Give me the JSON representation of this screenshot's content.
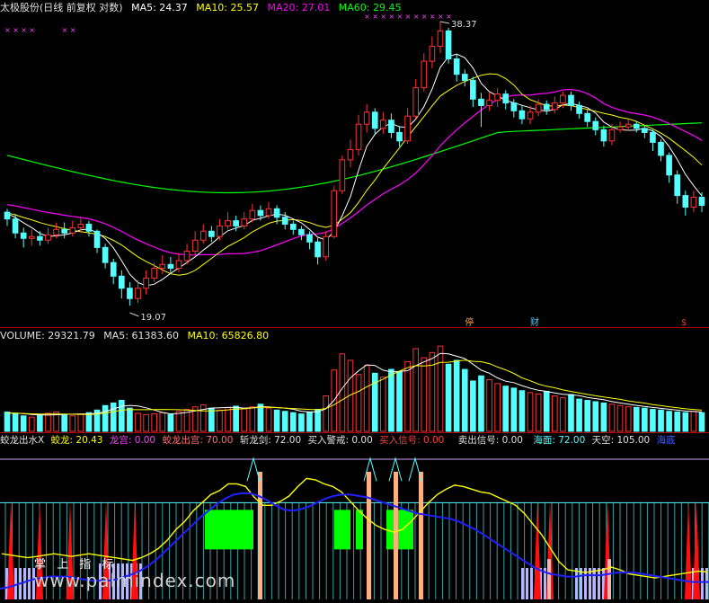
{
  "price_header": {
    "title": "太极股份(日线 前复权 对数)",
    "ma5": "MA5: 24.37",
    "ma10": "MA10: 25.57",
    "ma20": "MA20: 27.01",
    "ma60": "MA60: 29.45"
  },
  "price_annotations": {
    "high": "38.37",
    "low": "19.07",
    "marker1": "停",
    "marker2": "财",
    "marker3": "$"
  },
  "volume_header": {
    "volume": "VOLUME: 29321.79",
    "ma5": "MA5: 61383.60",
    "ma10": "MA10: 65826.80"
  },
  "indicator_header": {
    "name": "蛟龙出水X",
    "jiaolong": "蛟龙: 20.43",
    "longgong": "龙宫: 0.00",
    "chugong": "蛟龙出宫: 70.00",
    "zhanlongjian": "斩龙剑: 72.00",
    "maijing": "买入警戒: 0.00",
    "mairu": "买入信号: 0.00",
    "maichu": "卖出信号: 0.00",
    "haimian": "海面: 72.00",
    "tiankong": "天空: 105.00",
    "haidi": "海底"
  },
  "watermark": {
    "line1": "掌 上 指 标",
    "line2": "www.palmindex.com"
  },
  "colors": {
    "up": "#ff3232",
    "down": "#54ffff",
    "ma5": "#ffffff",
    "ma10": "#ffff00",
    "ma20": "#ff00ff",
    "ma60": "#00ff00",
    "separator": "#b00000"
  },
  "chart_data": {
    "type": "candlestick",
    "high_label": 38.37,
    "low_label": 19.07,
    "y_scale": "log",
    "candles": [
      [
        24,
        23.6,
        24.2,
        23.2
      ],
      [
        23.6,
        22.8,
        23.9,
        22.5
      ],
      [
        22.8,
        22.5,
        23.1,
        22.0
      ],
      [
        22.5,
        22.6,
        23.0,
        22.1
      ],
      [
        22.6,
        22.4,
        22.9,
        22.1
      ],
      [
        22.4,
        22.7,
        23.1,
        22.2
      ],
      [
        22.7,
        23.0,
        23.4,
        22.5
      ],
      [
        23.0,
        22.8,
        23.4,
        22.5
      ],
      [
        22.8,
        23.1,
        23.5,
        22.6
      ],
      [
        23.1,
        23.3,
        23.7,
        22.8
      ],
      [
        23.3,
        22.9,
        23.5,
        22.6
      ],
      [
        22.9,
        22.0,
        23.0,
        21.7
      ],
      [
        22.0,
        21.2,
        22.2,
        20.9
      ],
      [
        21.2,
        20.5,
        21.4,
        20.1
      ],
      [
        20.5,
        19.9,
        20.8,
        19.4
      ],
      [
        19.9,
        19.4,
        20.2,
        19.07
      ],
      [
        19.4,
        19.9,
        20.3,
        19.2
      ],
      [
        19.9,
        20.4,
        20.8,
        19.6
      ],
      [
        20.4,
        20.9,
        21.2,
        20.2
      ],
      [
        20.9,
        21.1,
        21.6,
        20.6
      ],
      [
        21.1,
        20.9,
        21.5,
        20.6
      ],
      [
        20.9,
        21.3,
        21.7,
        20.7
      ],
      [
        21.3,
        21.8,
        22.2,
        21.1
      ],
      [
        21.8,
        22.4,
        22.9,
        21.6
      ],
      [
        22.4,
        22.9,
        23.3,
        22.2
      ],
      [
        22.9,
        22.6,
        23.2,
        22.3
      ],
      [
        22.6,
        23.2,
        23.6,
        22.4
      ],
      [
        23.2,
        23.5,
        24.0,
        23.0
      ],
      [
        23.5,
        23.2,
        23.8,
        22.9
      ],
      [
        23.2,
        23.6,
        24.0,
        23.0
      ],
      [
        23.6,
        24.1,
        24.5,
        23.4
      ],
      [
        24.1,
        23.8,
        24.4,
        23.5
      ],
      [
        23.8,
        24.2,
        24.6,
        23.6
      ],
      [
        24.2,
        23.7,
        24.4,
        23.3
      ],
      [
        23.7,
        23.3,
        24.0,
        23.0
      ],
      [
        23.3,
        23.0,
        23.5,
        22.7
      ],
      [
        23.0,
        22.7,
        23.2,
        22.4
      ],
      [
        22.7,
        22.3,
        22.9,
        21.9
      ],
      [
        22.3,
        21.5,
        22.5,
        21.1
      ],
      [
        21.5,
        22.6,
        22.9,
        21.3
      ],
      [
        22.6,
        25.3,
        25.6,
        22.5
      ],
      [
        25.3,
        27.3,
        27.6,
        25.1
      ],
      [
        27.3,
        28.0,
        28.7,
        26.8
      ],
      [
        28.0,
        29.8,
        30.5,
        27.6
      ],
      [
        29.8,
        30.7,
        31.3,
        29.2
      ],
      [
        30.7,
        29.5,
        31.0,
        29.0
      ],
      [
        29.5,
        30.1,
        30.7,
        29.1
      ],
      [
        30.1,
        29.2,
        30.6,
        28.8
      ],
      [
        29.2,
        28.6,
        29.6,
        28.2
      ],
      [
        28.6,
        30.4,
        31.0,
        28.4
      ],
      [
        30.4,
        32.6,
        33.3,
        30.2
      ],
      [
        32.6,
        34.8,
        35.5,
        32.3
      ],
      [
        34.8,
        36.1,
        37.0,
        34.2
      ],
      [
        36.1,
        37.5,
        38.37,
        35.5
      ],
      [
        37.5,
        35.0,
        37.8,
        34.6
      ],
      [
        35.0,
        33.7,
        35.4,
        33.1
      ],
      [
        33.7,
        33.2,
        34.1,
        32.7
      ],
      [
        33.2,
        31.7,
        33.5,
        31.1
      ],
      [
        31.7,
        31.2,
        32.2,
        29.6
      ],
      [
        31.2,
        31.6,
        32.2,
        30.8
      ],
      [
        31.6,
        32.1,
        32.6,
        31.1
      ],
      [
        32.1,
        31.4,
        32.4,
        30.9
      ],
      [
        31.4,
        30.8,
        31.7,
        30.3
      ],
      [
        30.8,
        30.2,
        31.2,
        29.8
      ],
      [
        30.2,
        30.7,
        31.2,
        29.8
      ],
      [
        30.7,
        31.3,
        31.7,
        30.4
      ],
      [
        31.3,
        30.9,
        31.6,
        30.5
      ],
      [
        30.9,
        31.4,
        31.9,
        30.6
      ],
      [
        31.4,
        32.0,
        32.3,
        31.0
      ],
      [
        32.0,
        31.2,
        32.3,
        30.8
      ],
      [
        31.2,
        30.6,
        31.5,
        30.2
      ],
      [
        30.6,
        30.0,
        30.9,
        29.6
      ],
      [
        30.0,
        29.4,
        30.3,
        29.0
      ],
      [
        29.4,
        28.6,
        29.7,
        28.2
      ],
      [
        28.6,
        29.4,
        29.8,
        28.3
      ],
      [
        29.4,
        29.6,
        30.0,
        29.2
      ],
      [
        29.6,
        29.8,
        30.2,
        29.3
      ],
      [
        29.8,
        29.5,
        30.0,
        29.2
      ],
      [
        29.5,
        29.2,
        29.7,
        28.8
      ],
      [
        29.2,
        28.5,
        29.4,
        27.9
      ],
      [
        28.5,
        27.6,
        28.7,
        27.2
      ],
      [
        27.6,
        26.3,
        27.8,
        25.8
      ],
      [
        26.3,
        25.0,
        26.6,
        24.5
      ],
      [
        25.0,
        24.3,
        25.3,
        23.8
      ],
      [
        24.3,
        24.9,
        25.3,
        24.0
      ],
      [
        24.9,
        24.4,
        25.2,
        24.0
      ]
    ],
    "volumes": [
      30,
      27,
      24,
      22,
      25,
      28,
      30,
      26,
      24,
      27,
      29,
      33,
      40,
      44,
      48,
      36,
      28,
      26,
      27,
      29,
      26,
      31,
      34,
      38,
      41,
      36,
      33,
      37,
      39,
      35,
      38,
      42,
      36,
      33,
      31,
      29,
      27,
      30,
      34,
      55,
      95,
      120,
      110,
      88,
      102,
      90,
      84,
      96,
      92,
      108,
      128,
      114,
      122,
      132,
      104,
      110,
      96,
      78,
      86,
      80,
      74,
      70,
      67,
      63,
      60,
      58,
      62,
      55,
      52,
      57,
      50,
      48,
      46,
      44,
      42,
      40,
      38,
      37,
      36,
      34,
      33,
      31,
      30,
      29,
      31,
      29
    ],
    "indicator": {
      "jiaolong": [
        34,
        33,
        32,
        31,
        32,
        33,
        34,
        33,
        32,
        33,
        34,
        33,
        32,
        31,
        30,
        29,
        31,
        34,
        38,
        44,
        52,
        58,
        66,
        72,
        78,
        81,
        86,
        86,
        84,
        76,
        70,
        70,
        73,
        77,
        84,
        90,
        89,
        86,
        84,
        80,
        73,
        66,
        60,
        55,
        52,
        50,
        52,
        58,
        65,
        72,
        78,
        82,
        85,
        84,
        82,
        80,
        79,
        76,
        73,
        70,
        64,
        56,
        48,
        38,
        28,
        22,
        21,
        20,
        21,
        22,
        24,
        22,
        19,
        18,
        17,
        16,
        17,
        18,
        19,
        20,
        21,
        20.43
      ],
      "longgong": [
        8,
        9,
        11,
        13,
        15,
        16,
        17,
        17,
        17,
        16,
        15,
        14,
        14,
        14,
        15,
        17,
        19,
        22,
        26,
        31,
        37,
        43,
        49,
        55,
        61,
        66,
        71,
        75,
        78,
        79,
        79,
        77,
        74,
        70,
        67,
        66,
        67,
        69,
        72,
        75,
        77,
        78,
        78,
        77,
        76,
        74,
        72,
        70,
        68,
        66,
        64,
        63,
        62,
        61,
        60,
        58,
        55,
        52,
        48,
        44,
        40,
        36,
        32,
        28,
        24,
        21,
        19,
        18,
        17,
        17,
        18,
        18,
        18,
        19,
        20,
        20,
        20,
        19,
        18,
        17,
        16,
        15,
        14,
        13,
        13,
        13
      ]
    }
  }
}
